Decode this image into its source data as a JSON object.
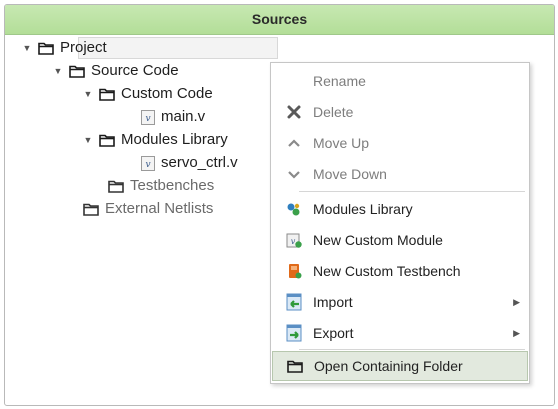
{
  "panel": {
    "title": "Sources"
  },
  "tree": {
    "project": "Project",
    "source_code": "Source Code",
    "custom_code": "Custom Code",
    "main_file": "main.v",
    "modules_library": "Modules Library",
    "servo_file": "servo_ctrl.v",
    "testbenches": "Testbenches",
    "external_netlists": "External Netlists"
  },
  "menu": {
    "rename": "Rename",
    "delete": "Delete",
    "move_up": "Move Up",
    "move_down": "Move Down",
    "modules_library": "Modules Library",
    "new_custom_module": "New Custom Module",
    "new_custom_testbench": "New Custom Testbench",
    "import": "Import",
    "export": "Export",
    "open_containing_folder": "Open Containing Folder"
  },
  "colors": {
    "header": "#b3de98",
    "highlight": "#e2e9de"
  }
}
